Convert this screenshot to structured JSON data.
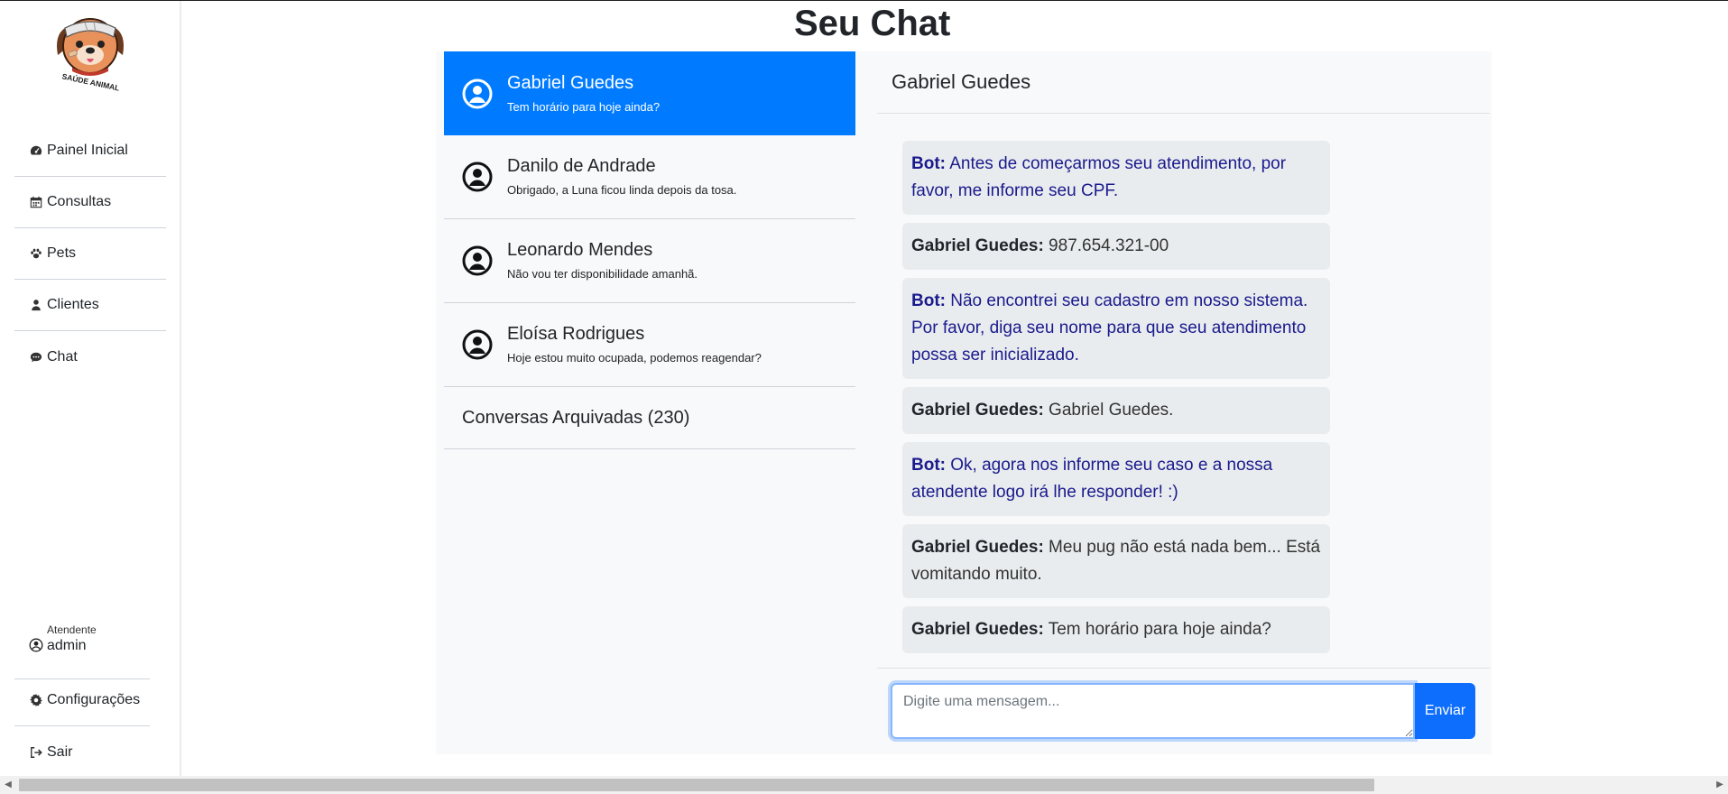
{
  "page_title": "Seu Chat",
  "logo": {
    "text": "SAÚDE ANIMAL"
  },
  "sidebar": {
    "items": [
      {
        "label": "Painel Inicial",
        "icon": "dashboard-icon"
      },
      {
        "label": "Consultas",
        "icon": "calendar-icon"
      },
      {
        "label": "Pets",
        "icon": "paw-icon"
      },
      {
        "label": "Clientes",
        "icon": "user-icon"
      },
      {
        "label": "Chat",
        "icon": "chat-icon"
      }
    ],
    "user": {
      "role": "Atendente",
      "name": "admin",
      "icon": "user-circle-icon"
    },
    "bottom_items": [
      {
        "label": "Configurações",
        "icon": "gear-icon"
      },
      {
        "label": "Sair",
        "icon": "sign-out-icon"
      }
    ]
  },
  "conversations": [
    {
      "name": "Gabriel Guedes",
      "preview": "Tem horário para hoje ainda?",
      "active": true
    },
    {
      "name": "Danilo de Andrade",
      "preview": "Obrigado, a Luna ficou linda depois da tosa.",
      "active": false
    },
    {
      "name": "Leonardo Mendes",
      "preview": "Não vou ter disponibilidade amanhã.",
      "active": false
    },
    {
      "name": "Eloísa Rodrigues",
      "preview": "Hoje estou muito ocupada, podemos reagendar?",
      "active": false
    }
  ],
  "archived_label": "Conversas Arquivadas (230)",
  "chat": {
    "header": "Gabriel Guedes",
    "messages": [
      {
        "sender": "Bot:",
        "text": " Antes de começarmos seu atendimento, por favor, me informe seu CPF.",
        "type": "bot"
      },
      {
        "sender": "Gabriel Guedes:",
        "text": " 987.654.321-00",
        "type": "user"
      },
      {
        "sender": "Bot:",
        "text": " Não encontrei seu cadastro em nosso sistema. Por favor, diga seu nome para que seu atendimento possa ser inicializado.",
        "type": "bot"
      },
      {
        "sender": "Gabriel Guedes:",
        "text": " Gabriel Guedes.",
        "type": "user"
      },
      {
        "sender": "Bot:",
        "text": " Ok, agora nos informe seu caso e a nossa atendente logo irá lhe responder! :)",
        "type": "bot"
      },
      {
        "sender": "Gabriel Guedes:",
        "text": " Meu pug não está nada bem... Está vomitando muito.",
        "type": "user"
      },
      {
        "sender": "Gabriel Guedes:",
        "text": " Tem horário para hoje ainda?",
        "type": "user"
      }
    ],
    "input": {
      "value": "",
      "placeholder": "Digite uma mensagem..."
    },
    "send_label": "Enviar"
  },
  "colors": {
    "primary": "#007bff",
    "bot_text": "#1a1a8c",
    "panel_bg": "#f8f9fa"
  }
}
